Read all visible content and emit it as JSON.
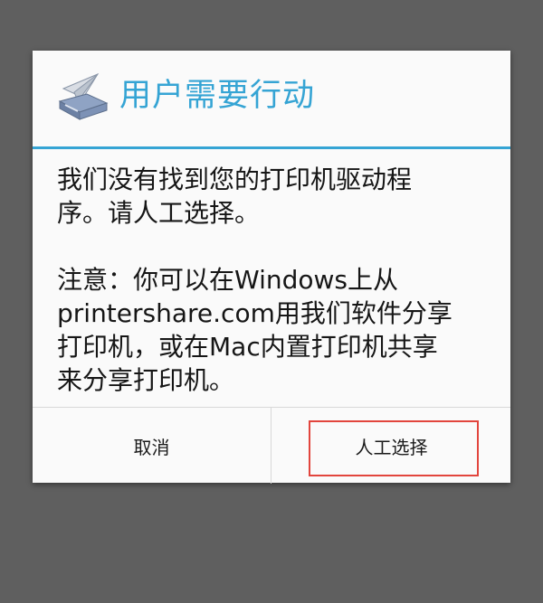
{
  "dialog": {
    "icon": "printer-paper-plane-icon",
    "title": "用户需要行动",
    "body_text_1": "我们没有找到您的打印机驱动程\n序。请人工选择。",
    "body_text_2": "注意：你可以在Windows上从\nprintershare.com用我们软件分享\n打印机，或在Mac内置打印机共享\n来分享打印机。"
  },
  "buttons": {
    "cancel_label": "取消",
    "manual_select_label": "人工选择"
  },
  "colors": {
    "accent": "#35a4d4",
    "highlight": "#e2453d",
    "backdrop": "#5f5f5f"
  }
}
